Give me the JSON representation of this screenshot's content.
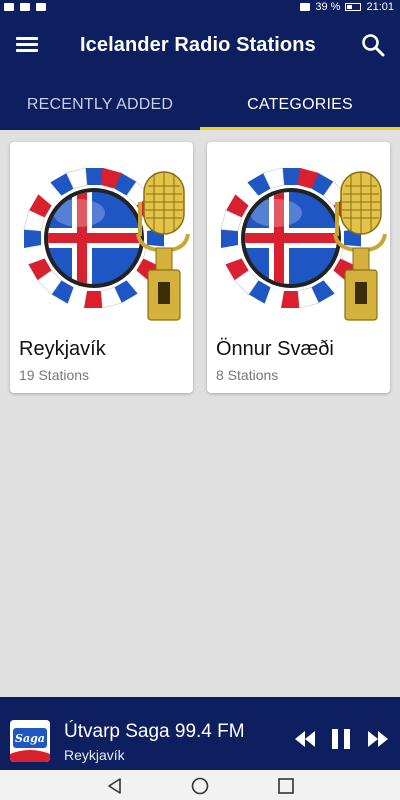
{
  "status_bar": {
    "battery_percent": "39 %",
    "time": "21:01"
  },
  "app_bar": {
    "title": "Icelander Radio Stations",
    "menu_icon": "hamburger-icon",
    "search_icon": "search-icon"
  },
  "tabs": [
    {
      "label": "RECENTLY ADDED",
      "selected": false
    },
    {
      "label": "CATEGORIES",
      "selected": true
    }
  ],
  "categories": [
    {
      "name": "Reykjavík",
      "count": "19 Stations"
    },
    {
      "name": "Önnur Svæði",
      "count": "8 Stations"
    }
  ],
  "now_playing": {
    "title": "Útvarp Saga 99.4 FM",
    "subtitle": "Reykjavík",
    "logo_text": "Saga"
  },
  "colors": {
    "primary": "#0d1f5e",
    "accent": "#f2d21a",
    "background": "#e0e0e0"
  }
}
